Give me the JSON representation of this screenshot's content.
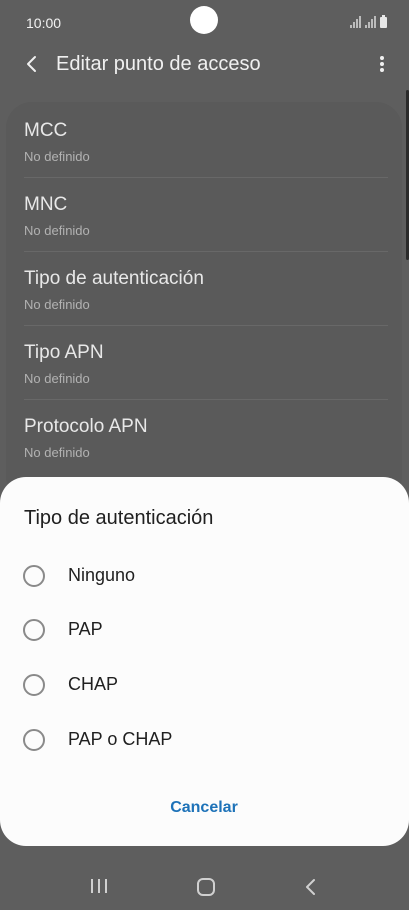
{
  "status_bar": {
    "time": "10:00"
  },
  "app_bar": {
    "title": "Editar punto de acceso"
  },
  "settings": [
    {
      "title": "MCC",
      "value": "No definido"
    },
    {
      "title": "MNC",
      "value": "No definido"
    },
    {
      "title": "Tipo de autenticación",
      "value": "No definido"
    },
    {
      "title": "Tipo APN",
      "value": "No definido"
    },
    {
      "title": "Protocolo APN",
      "value": "No definido"
    }
  ],
  "dialog": {
    "title": "Tipo de autenticación",
    "options": [
      {
        "label": "Ninguno",
        "selected": false
      },
      {
        "label": "PAP",
        "selected": false
      },
      {
        "label": "CHAP",
        "selected": false
      },
      {
        "label": "PAP o CHAP",
        "selected": false
      }
    ],
    "cancel_label": "Cancelar"
  },
  "colors": {
    "accent": "#1d72b8",
    "scrim": "#5e5e5e",
    "dialog_bg": "#fcfcfc"
  },
  "icons": {
    "back": "back-arrow-icon",
    "more": "more-vertical-icon",
    "nav_recents": "recents-icon",
    "nav_home": "home-icon",
    "nav_back": "nav-back-icon"
  }
}
